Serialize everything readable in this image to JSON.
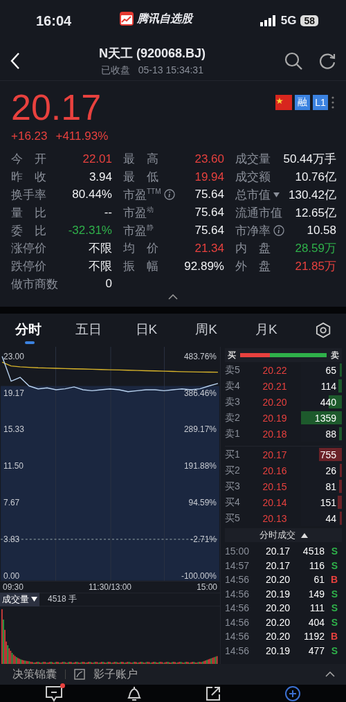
{
  "status_bar": {
    "time": "16:04",
    "app_name": "腾讯自选股",
    "network": "5G",
    "battery": "58"
  },
  "header": {
    "title": "N天工 (920068.BJ)",
    "market_state": "已收盘",
    "timestamp": "05-13 15:34:31"
  },
  "quote": {
    "price": "20.17",
    "change": "+16.23",
    "change_percent": "+411.93%",
    "badges": [
      {
        "kind": "flag"
      },
      {
        "kind": "text",
        "label": "融"
      },
      {
        "kind": "text",
        "label": "L1"
      }
    ]
  },
  "stats": [
    {
      "cells": [
        {
          "kind": "plain",
          "label": "今　开",
          "value": "22.01",
          "color": "#e8413e"
        },
        {
          "kind": "plain",
          "label": "最　高",
          "value": "23.60",
          "color": "#e8413e"
        },
        {
          "kind": "plain",
          "label": "成交量",
          "value": "50.44万手",
          "color": "#f2f3f5"
        }
      ]
    },
    {
      "cells": [
        {
          "kind": "plain",
          "label": "昨　收",
          "value": "3.94",
          "color": "#f2f3f5"
        },
        {
          "kind": "plain",
          "label": "最　低",
          "value": "19.94",
          "color": "#e8413e"
        },
        {
          "kind": "plain",
          "label": "成交额",
          "value": "10.76亿",
          "color": "#f2f3f5"
        }
      ]
    },
    {
      "cells": [
        {
          "kind": "plain",
          "label": "换手率",
          "value": "80.44%",
          "color": "#f2f3f5"
        },
        {
          "kind": "info",
          "label": "市盈$^{TTM}$",
          "value": "75.64",
          "color": "#f2f3f5"
        },
        {
          "kind": "dropdown",
          "label": "总市值",
          "value": "130.42亿",
          "color": "#f2f3f5"
        }
      ]
    },
    {
      "cells": [
        {
          "kind": "plain",
          "label": "量　比",
          "value": "--",
          "color": "#f2f3f5"
        },
        {
          "kind": "plain",
          "label": "市盈$^{动}$",
          "value": "75.64",
          "color": "#f2f3f5"
        },
        {
          "kind": "plain",
          "label": "流通市值",
          "value": "12.65亿",
          "color": "#f2f3f5"
        }
      ]
    },
    {
      "cells": [
        {
          "kind": "plain",
          "label": "委　比",
          "value": "-32.31%",
          "color": "#2fb14a"
        },
        {
          "kind": "plain",
          "label": "市盈$^{静}$",
          "value": "75.64",
          "color": "#f2f3f5"
        },
        {
          "kind": "info",
          "label": "市净率",
          "value": "10.58",
          "color": "#f2f3f5"
        }
      ]
    },
    {
      "cells": [
        {
          "kind": "plain",
          "label": "涨停价",
          "value": "不限",
          "color": "#f2f3f5"
        },
        {
          "kind": "plain",
          "label": "均　价",
          "value": "21.34",
          "color": "#e8413e"
        },
        {
          "kind": "plain",
          "label": "内　盘",
          "value": "28.59万",
          "color": "#2fb14a"
        }
      ]
    },
    {
      "cells": [
        {
          "kind": "plain",
          "label": "跌停价",
          "value": "不限",
          "color": "#f2f3f5"
        },
        {
          "kind": "plain",
          "label": "振　幅",
          "value": "92.89%",
          "color": "#f2f3f5"
        },
        {
          "kind": "plain",
          "label": "外　盘",
          "value": "21.85万",
          "color": "#e8413e"
        }
      ]
    },
    {
      "cells": [
        {
          "kind": "plain",
          "label": "做市商数",
          "value": "0",
          "color": "#f2f3f5"
        }
      ]
    }
  ],
  "chart_tabs": [
    {
      "label": "分时",
      "selected": true
    },
    {
      "label": "五日",
      "selected": false
    },
    {
      "label": "日K",
      "selected": false
    },
    {
      "label": "周K",
      "selected": false
    },
    {
      "label": "月K",
      "selected": false
    }
  ],
  "chart": {
    "chart_data": {
      "type": "line",
      "grid": true,
      "ref_lines": [
        {
          "axis": "y",
          "value": 3.83
        }
      ],
      "series": [
        {
          "color": "#b9d3f0",
          "values": [
            23.0,
            20.4,
            20.8,
            19.9,
            19.6,
            19.7,
            19.5,
            19.6,
            19.8,
            19.5,
            19.4,
            19.5,
            19.6,
            19.5,
            19.3,
            19.4,
            19.5,
            19.5,
            19.4,
            19.5,
            19.6,
            19.5,
            19.6,
            19.9,
            20.17
          ]
        },
        {
          "color": "#d9b52a",
          "values": [
            22.4,
            22.0,
            21.9,
            21.85,
            21.8,
            21.78,
            21.75,
            21.72,
            21.7,
            21.68,
            21.65,
            21.62,
            21.6,
            21.58,
            21.55,
            21.52,
            21.5,
            21.48,
            21.45,
            21.43,
            21.4,
            21.38,
            21.36,
            21.35,
            21.34
          ]
        }
      ],
      "ylim": [
        -0.5,
        24
      ],
      "yticks": [
        {
          "value": 23,
          "label": "23.00"
        },
        {
          "value": 19.17,
          "label": "19.17"
        },
        {
          "value": 15.33,
          "label": "15.33"
        },
        {
          "value": 11.5,
          "label": "11.50"
        },
        {
          "value": 7.67,
          "label": "7.67"
        },
        {
          "value": 3.83,
          "label": "3.83"
        },
        {
          "value": 0,
          "label": "0.00"
        }
      ]
    },
    "percent_labels": [
      "483.76%",
      "386.46%",
      "289.17%",
      "191.88%",
      "94.59%",
      "-2.71%",
      "-100.00%"
    ],
    "time_labels": [
      "09:30",
      "11:30/13:00",
      "15:00"
    ],
    "volume_selector": "成交量",
    "volume_value": "4518 手"
  },
  "order_book": {
    "buy_label": "买",
    "sell_label": "卖",
    "level": 0.34,
    "asks": [
      {
        "label": "卖5",
        "price": "20.22",
        "volume": "65",
        "level": 0.05
      },
      {
        "label": "卖4",
        "price": "20.21",
        "volume": "114",
        "level": 0.08
      },
      {
        "label": "卖3",
        "price": "20.20",
        "volume": "440",
        "level": 0.32
      },
      {
        "label": "卖2",
        "price": "20.19",
        "volume": "1359",
        "level": 1
      },
      {
        "label": "卖1",
        "price": "20.18",
        "volume": "88",
        "level": 0.06
      }
    ],
    "bids": [
      {
        "label": "买1",
        "price": "20.17",
        "volume": "755",
        "level": 0.56
      },
      {
        "label": "买2",
        "price": "20.16",
        "volume": "26",
        "level": 0.02
      },
      {
        "label": "买3",
        "price": "20.15",
        "volume": "81",
        "level": 0.06
      },
      {
        "label": "买4",
        "price": "20.14",
        "volume": "151",
        "level": 0.11
      },
      {
        "label": "买5",
        "price": "20.13",
        "volume": "44",
        "level": 0.03
      }
    ]
  },
  "trades": {
    "title": "分时成交",
    "rows": [
      {
        "time": "15:00",
        "price": "20.17",
        "volume": "4518",
        "flag": "S",
        "kind": "sell"
      },
      {
        "time": "14:57",
        "price": "20.17",
        "volume": "116",
        "flag": "S",
        "kind": "sell"
      },
      {
        "time": "14:56",
        "price": "20.20",
        "volume": "61",
        "flag": "B",
        "kind": "buy"
      },
      {
        "time": "14:56",
        "price": "20.19",
        "volume": "149",
        "flag": "S",
        "kind": "sell"
      },
      {
        "time": "14:56",
        "price": "20.20",
        "volume": "111",
        "flag": "S",
        "kind": "sell"
      },
      {
        "time": "14:56",
        "price": "20.20",
        "volume": "404",
        "flag": "S",
        "kind": "sell"
      },
      {
        "time": "14:56",
        "price": "20.20",
        "volume": "1192",
        "flag": "B",
        "kind": "buy"
      },
      {
        "time": "14:56",
        "price": "20.19",
        "volume": "477",
        "flag": "S",
        "kind": "sell"
      }
    ]
  },
  "bottom_links": [
    "决策锦囊",
    "影子账户"
  ],
  "tab_bar": [
    {
      "kind": "message",
      "unread": true
    },
    {
      "kind": "bell",
      "unread": false
    },
    {
      "kind": "share",
      "unread": false
    },
    {
      "kind": "add",
      "unread": false
    }
  ]
}
